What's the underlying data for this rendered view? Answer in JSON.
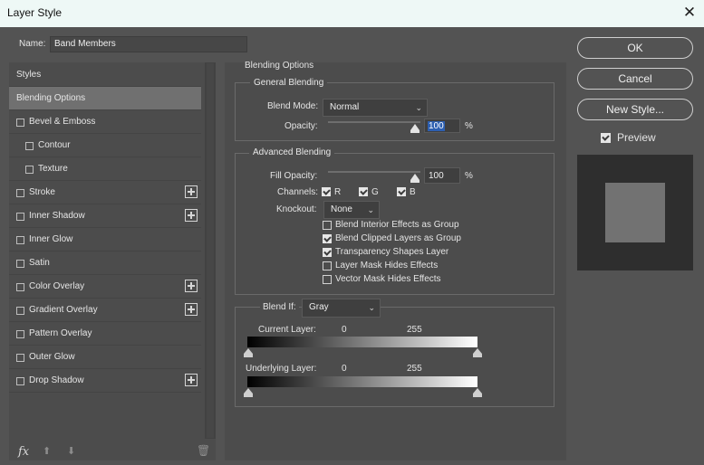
{
  "window": {
    "title": "Layer Style",
    "close_glyph": "✕"
  },
  "name_row": {
    "label": "Name:",
    "value": "Band Members"
  },
  "styles_list": [
    {
      "label": "Styles",
      "checkbox": false,
      "plus": false,
      "selected": false,
      "indent": false
    },
    {
      "label": "Blending Options",
      "checkbox": false,
      "plus": false,
      "selected": true,
      "indent": false
    },
    {
      "label": "Bevel & Emboss",
      "checkbox": true,
      "plus": false,
      "selected": false,
      "indent": false
    },
    {
      "label": "Contour",
      "checkbox": true,
      "plus": false,
      "selected": false,
      "indent": true
    },
    {
      "label": "Texture",
      "checkbox": true,
      "plus": false,
      "selected": false,
      "indent": true
    },
    {
      "label": "Stroke",
      "checkbox": true,
      "plus": true,
      "selected": false,
      "indent": false
    },
    {
      "label": "Inner Shadow",
      "checkbox": true,
      "plus": true,
      "selected": false,
      "indent": false
    },
    {
      "label": "Inner Glow",
      "checkbox": true,
      "plus": false,
      "selected": false,
      "indent": false
    },
    {
      "label": "Satin",
      "checkbox": true,
      "plus": false,
      "selected": false,
      "indent": false
    },
    {
      "label": "Color Overlay",
      "checkbox": true,
      "plus": true,
      "selected": false,
      "indent": false
    },
    {
      "label": "Gradient Overlay",
      "checkbox": true,
      "plus": true,
      "selected": false,
      "indent": false
    },
    {
      "label": "Pattern Overlay",
      "checkbox": true,
      "plus": false,
      "selected": false,
      "indent": false
    },
    {
      "label": "Outer Glow",
      "checkbox": true,
      "plus": false,
      "selected": false,
      "indent": false
    },
    {
      "label": "Drop Shadow",
      "checkbox": true,
      "plus": true,
      "selected": false,
      "indent": false
    }
  ],
  "footer_icons": {
    "fx": "fx",
    "up": "⬆",
    "down": "⬇",
    "trash": "🗑"
  },
  "blending": {
    "section_title": "Blending Options",
    "general": {
      "title": "General Blending",
      "blend_mode_label": "Blend Mode:",
      "blend_mode_value": "Normal",
      "opacity_label": "Opacity:",
      "opacity_value": "100",
      "opacity_unit": "%"
    },
    "advanced": {
      "title": "Advanced Blending",
      "fill_opacity_label": "Fill Opacity:",
      "fill_opacity_value": "100",
      "fill_opacity_unit": "%",
      "channels_label": "Channels:",
      "channels": [
        {
          "label": "R",
          "checked": true
        },
        {
          "label": "G",
          "checked": true
        },
        {
          "label": "B",
          "checked": true
        }
      ],
      "knockout_label": "Knockout:",
      "knockout_value": "None",
      "options": [
        {
          "label": "Blend Interior Effects as Group",
          "checked": false
        },
        {
          "label": "Blend Clipped Layers as Group",
          "checked": true
        },
        {
          "label": "Transparency Shapes Layer",
          "checked": true
        },
        {
          "label": "Layer Mask Hides Effects",
          "checked": false
        },
        {
          "label": "Vector Mask Hides Effects",
          "checked": false
        }
      ]
    },
    "blend_if": {
      "label": "Blend If:",
      "value": "Gray",
      "current_layer_label": "Current Layer:",
      "current_min": "0",
      "current_max": "255",
      "underlying_layer_label": "Underlying Layer:",
      "underlying_min": "0",
      "underlying_max": "255"
    }
  },
  "buttons": {
    "ok": "OK",
    "cancel": "Cancel",
    "new_style": "New Style..."
  },
  "preview": {
    "label": "Preview",
    "checked": true
  }
}
